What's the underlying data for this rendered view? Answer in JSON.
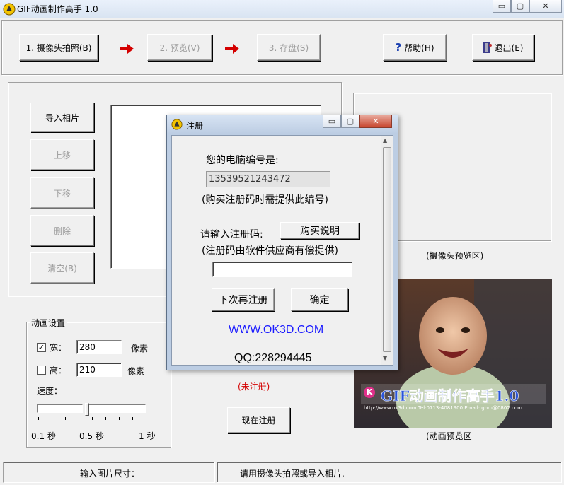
{
  "window": {
    "title": "GIF动画制作高手 1.0",
    "controls": [
      "▭",
      "▢",
      "✕"
    ]
  },
  "toolbar": {
    "camera_btn": "1. 摄像头拍照(B)",
    "preview_btn": "2. 预览(V)",
    "save_btn": "3. 存盘(S)",
    "help_btn": "帮助(H)",
    "exit_btn": "退出(E)"
  },
  "left_panel": {
    "import_btn": "导入相片",
    "up_btn": "上移",
    "down_btn": "下移",
    "delete_btn": "删除",
    "clear_btn": "清空(B)"
  },
  "anim_settings": {
    "group_title": "动画设置",
    "width_label": "宽：",
    "width_value": "280",
    "width_unit": "像素",
    "width_checked": true,
    "height_label": "高：",
    "height_value": "210",
    "height_unit": "像素",
    "height_checked": false,
    "speed_label": "速度：",
    "speed_ticks": [
      "0.1 秒",
      "0.5 秒",
      "1 秒"
    ],
    "speed_fraction": 0.45
  },
  "register": {
    "status": "(未注册)",
    "register_now_btn": "现在注册"
  },
  "preview": {
    "camera_caption": "(摄像头预览区)",
    "anim_caption": "(动画预览区",
    "banner_text": "GIF动画制作高手1.0",
    "banner_sub": "http://www.ok3d.com Tel:0713-4081900 Email: ghm@0802.com"
  },
  "status_bar": {
    "left": "输入图片尺寸：",
    "right": "请用摄像头拍照或导入相片."
  },
  "dialog": {
    "title": "注册",
    "pc_id_label": "您的电脑编号是:",
    "pc_id_value": "13539521243472",
    "pc_id_note": "(购买注册码时需提供此编号)",
    "code_label": "请输入注册码:",
    "buy_btn": "购买说明",
    "code_note": "(注册码由软件供应商有偿提供)",
    "code_value": "",
    "later_btn": "下次再注册",
    "ok_btn": "确定",
    "website": "WWW.OK3D.COM",
    "qq": "QQ:228294445"
  },
  "colors": {
    "accent_red": "#d40000",
    "link_blue": "#1a1aff",
    "disabled_text": "#9c9c9c"
  }
}
